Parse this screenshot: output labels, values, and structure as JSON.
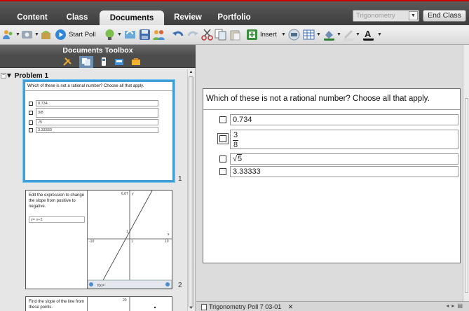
{
  "topbar": {
    "tabs": [
      {
        "label": "Content",
        "active": false
      },
      {
        "label": "Class",
        "active": false
      },
      {
        "label": "Documents",
        "active": true
      },
      {
        "label": "Review",
        "active": false
      },
      {
        "label": "Portfolio",
        "active": false
      }
    ],
    "class_select": {
      "value": "Trigonometry"
    },
    "end_class_label": "End Class",
    "accent_color": "#cc0000"
  },
  "toolbar": {
    "start_poll_label": "Start Poll",
    "insert_label": "Insert",
    "icons": [
      "users-icon",
      "screen-capture-icon",
      "send-to-class-icon",
      "start-poll-icon",
      "question-icon",
      "refresh-icon",
      "save-icon",
      "class-users-icon",
      "undo-icon",
      "redo-icon",
      "cut-icon",
      "copy-icon",
      "paste-icon",
      "insert-icon",
      "calculator-icon",
      "table-icon",
      "fill-color-icon",
      "line-color-icon",
      "text-color-icon"
    ]
  },
  "toolbox": {
    "title": "Documents Toolbox",
    "icons": [
      "tools-icon",
      "page-sorter-icon",
      "ti-smartview-icon",
      "content-explorer-icon",
      "utilities-icon"
    ],
    "problem_label": "Problem 1",
    "pages": [
      {
        "num": "1",
        "question": "Which of these is not a rational number? Choose all that apply.",
        "choices": [
          "0.734",
          "3/8",
          "√5",
          "3.33333"
        ]
      },
      {
        "num": "2",
        "instruction": "Edit the expression to change the slope from positive to negative.",
        "expr": "y= x+3",
        "graph_ticks": {
          "top": "6.67",
          "y_axis": "y",
          "left": "-10",
          "right": "10",
          "x_axis": "x",
          "mid": "1",
          "mid_x": "1"
        },
        "func_label": "f(x)="
      },
      {
        "num": "3",
        "instruction": "Find the slope of the line from these points.",
        "graph_top": "20"
      }
    ]
  },
  "document": {
    "question": "Which of these is not a rational number? Choose all that apply.",
    "choices": [
      {
        "text": "0.734"
      },
      {
        "numerator": "3",
        "denominator": "8"
      },
      {
        "radicand": "5"
      },
      {
        "text": "3.33333"
      }
    ]
  },
  "doc_tabs": {
    "active": "Trigonometry Poll 7 03-01",
    "close_symbol": "✕"
  }
}
